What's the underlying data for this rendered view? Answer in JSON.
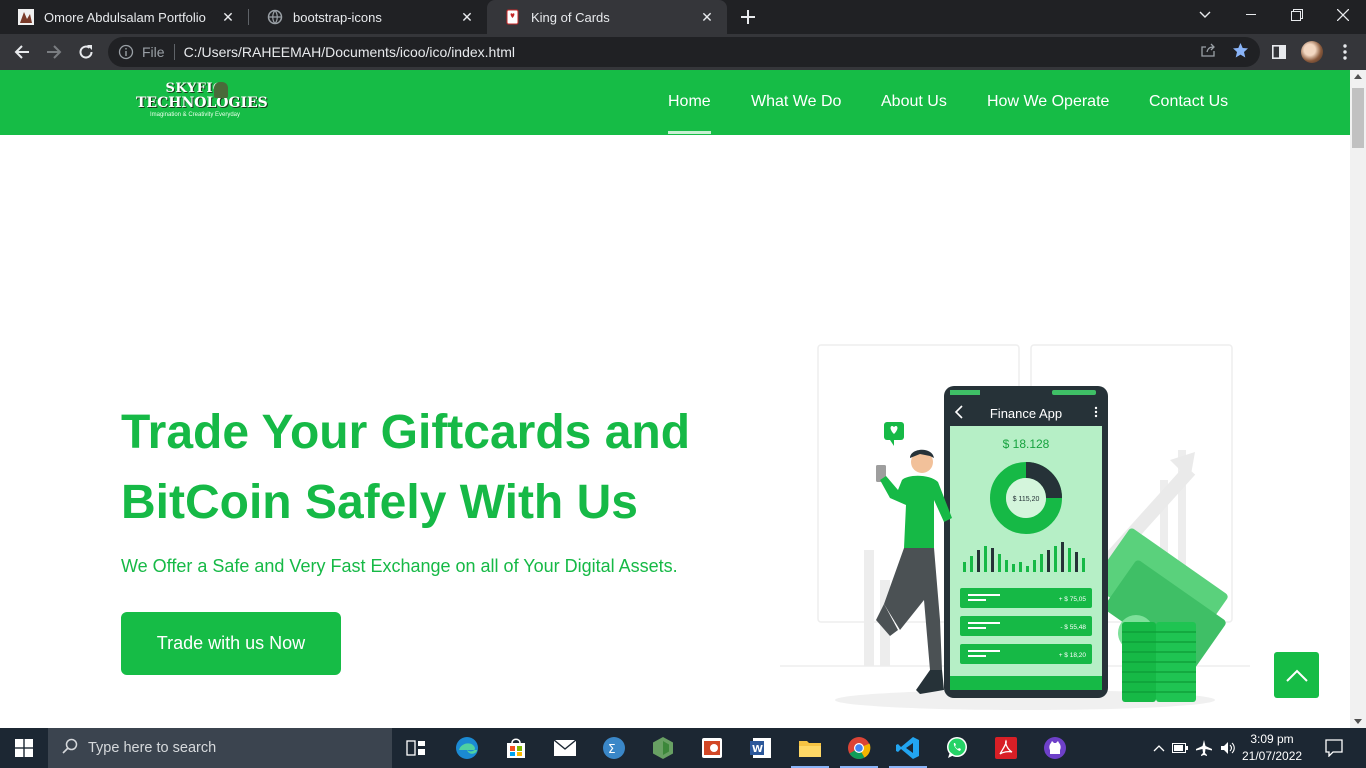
{
  "browser": {
    "tabs": [
      {
        "title": "Omore Abdulsalam Portfolio",
        "active": false
      },
      {
        "title": "bootstrap-icons",
        "active": false
      },
      {
        "title": "King of Cards",
        "active": true
      }
    ],
    "address": {
      "scheme_label": "File",
      "url": "C:/Users/RAHEEMAH/Documents/icoo/ico/index.html"
    }
  },
  "site": {
    "logo": {
      "line1": "SKYFIG",
      "line2": "TECHNOLOGIES",
      "tagline": "Imagination & Creativity Everyday"
    },
    "nav": [
      {
        "label": "Home",
        "active": true
      },
      {
        "label": "What We Do",
        "active": false
      },
      {
        "label": "About Us",
        "active": false
      },
      {
        "label": "How We Operate",
        "active": false
      },
      {
        "label": "Contact Us",
        "active": false
      }
    ],
    "hero": {
      "title": "Trade Your Giftcards and BitCoin Safely With Us",
      "subtitle": "We Offer a Safe and Very Fast Exchange on all of Your Digital Assets.",
      "cta": "Trade with us Now"
    },
    "illustration": {
      "app_title": "Finance App",
      "balance": "$ 18.128",
      "donut_value": "$ 115,20",
      "transactions": [
        "+ $ 75,05",
        "- $ 55,48",
        "+ $ 18,20"
      ]
    },
    "colors": {
      "brand_green": "#16bc46",
      "light_green": "#b6efc6",
      "dark_green": "#0e8a32"
    }
  },
  "taskbar": {
    "search_placeholder": "Type here to search",
    "time": "3:09 pm",
    "date": "21/07/2022",
    "apps": [
      "task-view-icon",
      "edge-icon",
      "store-icon",
      "mail-icon",
      "calculator-icon",
      "nodejs-icon",
      "powerpoint-icon",
      "word-icon",
      "file-explorer-icon",
      "chrome-icon",
      "vscode-icon",
      "whatsapp-icon",
      "acrobat-icon",
      "github-icon"
    ]
  }
}
